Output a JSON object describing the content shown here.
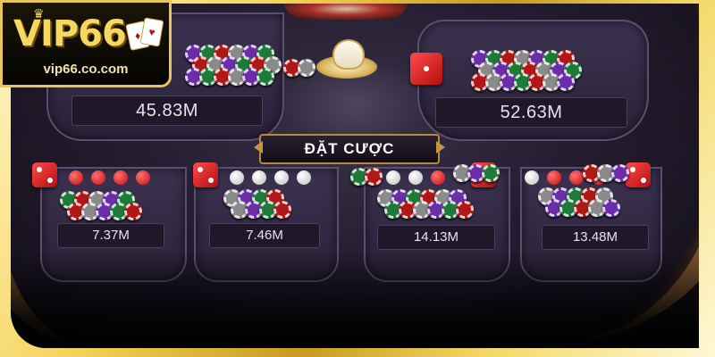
{
  "brand": {
    "logo_text": "VIP66",
    "url": "vip66.co.com"
  },
  "table": {
    "bet_label": "ĐẶT CƯỢC",
    "main_bets": [
      {
        "id": "left",
        "amount": "45.83M"
      },
      {
        "id": "right",
        "amount": "52.63M"
      }
    ],
    "side_bets": [
      {
        "id": "bet1",
        "amount": "7.37M"
      },
      {
        "id": "bet2",
        "amount": "7.46M"
      },
      {
        "id": "bet3",
        "amount": "14.13M"
      },
      {
        "id": "bet4",
        "amount": "13.48M"
      }
    ]
  },
  "colors": {
    "gold": "#f5d35a",
    "felt": "#3c3251",
    "dice_red": "#d81818",
    "chip_colors": [
      "#6a2ea8",
      "#1f7a3a",
      "#b01818",
      "#8a8a8a"
    ]
  }
}
